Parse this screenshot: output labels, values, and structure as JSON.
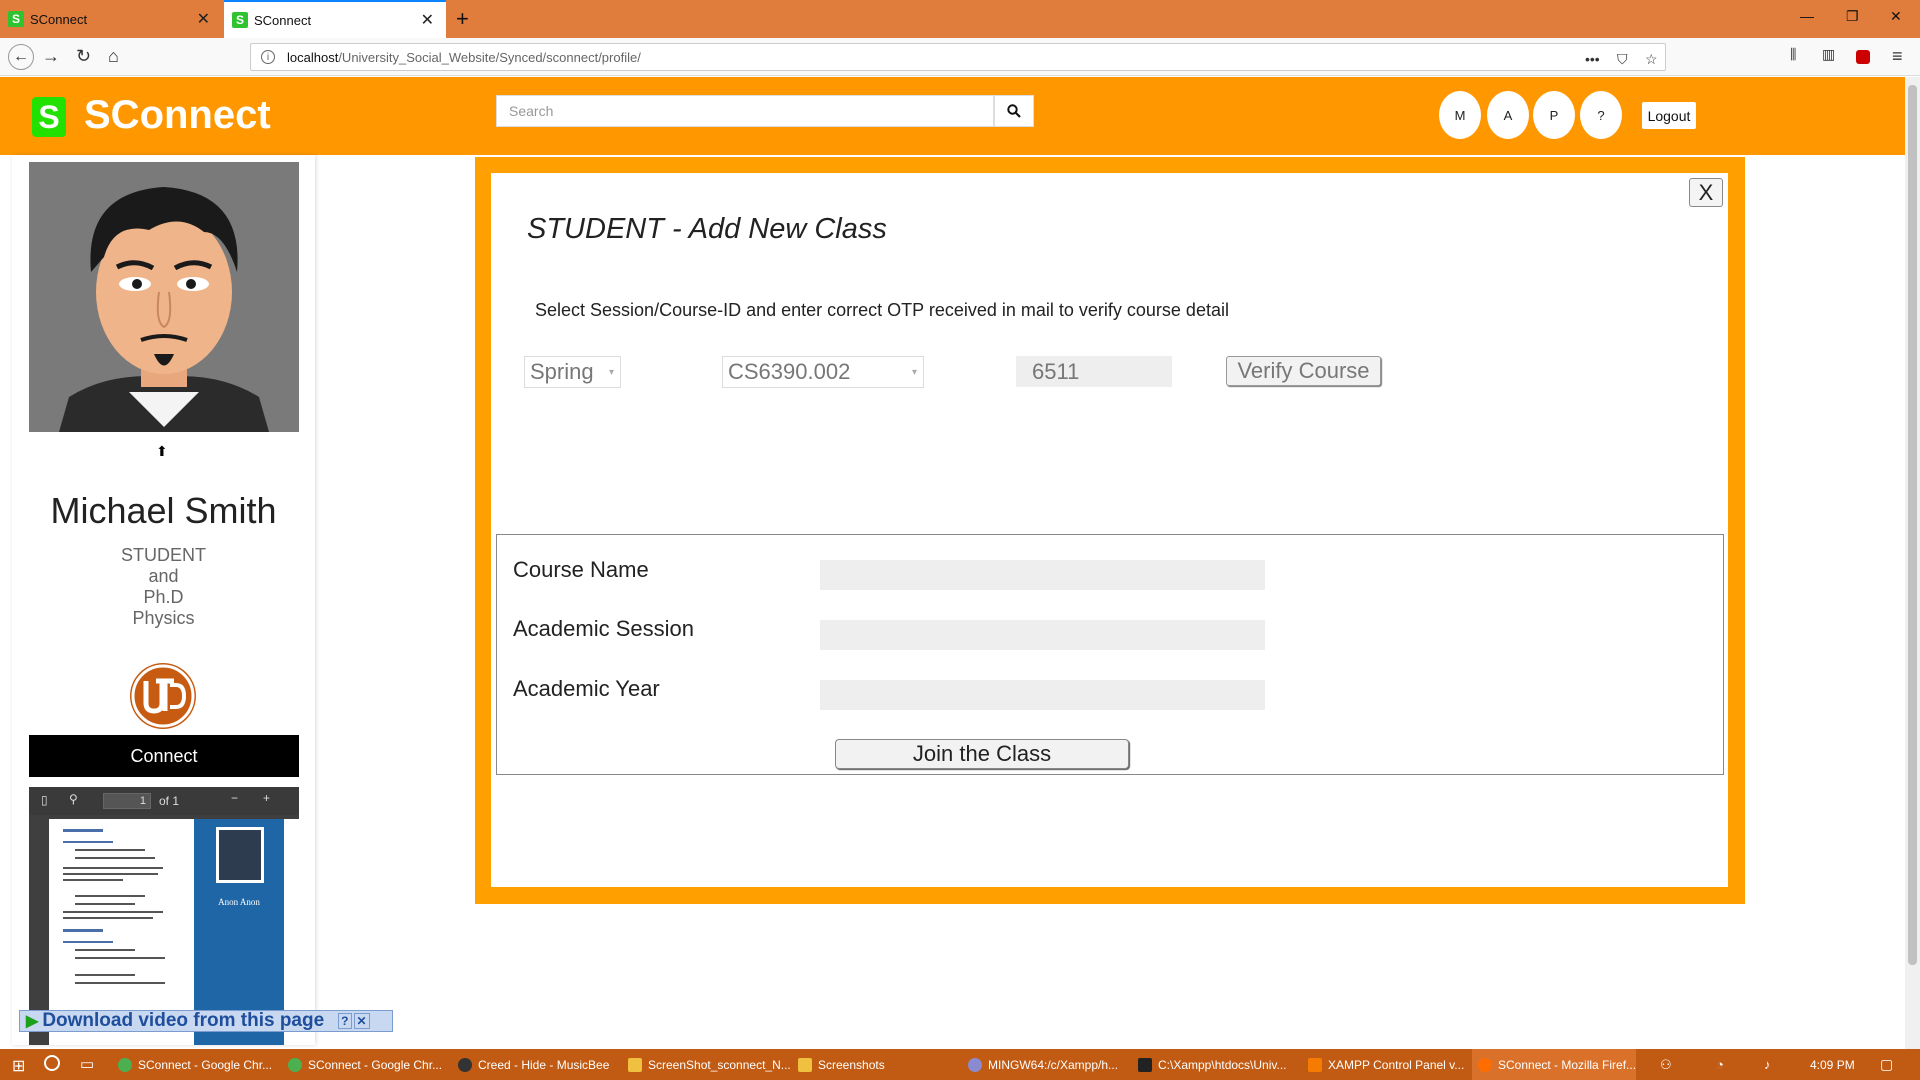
{
  "browser": {
    "tabs": [
      {
        "label": "SConnect",
        "favicon": "S"
      },
      {
        "label": "SConnect",
        "favicon": "S"
      }
    ],
    "url_host": "localhost",
    "url_path": "/University_Social_Website/Synced/sconnect/profile/",
    "info_glyph": "i",
    "new_tab_glyph": "+",
    "tab_close_glyph": "✕"
  },
  "header": {
    "logo_letter": "S",
    "title": "SConnect",
    "search_placeholder": "Search",
    "nav_buttons": [
      "M",
      "A",
      "P",
      "?"
    ],
    "logout_label": "Logout",
    "background_color": "#ff9800"
  },
  "profile": {
    "name": "Michael Smith",
    "lines": [
      "STUDENT",
      "and",
      "Ph.D",
      "Physics"
    ],
    "connect_label": "Connect",
    "pdf": {
      "page_value": "1",
      "page_total": "of 1",
      "person_name": "Anon Anon"
    }
  },
  "modal": {
    "close_label": "X",
    "title": "STUDENT - Add New Class",
    "description": "Select Session/Course-ID and enter correct OTP received in mail to verify course detail",
    "session_value": "Spring",
    "course_value": "CS6390.002",
    "otp_value": "6511",
    "verify_label": "Verify Course",
    "fields": [
      {
        "label": "Course Name",
        "value": ""
      },
      {
        "label": "Academic Session",
        "value": ""
      },
      {
        "label": "Academic Year",
        "value": ""
      }
    ],
    "join_label": "Join the Class",
    "border_color": "#ffa000"
  },
  "overlay": {
    "download_label": "Download video from this page"
  },
  "taskbar": {
    "items": [
      "SConnect - Google Chr...",
      "SConnect - Google Chr...",
      "Creed - Hide - MusicBee",
      "ScreenShot_sconnect_N...",
      "Screenshots",
      "MINGW64:/c/Xampp/h...",
      "C:\\Xampp\\htdocs\\Univ...",
      "XAMPP Control Panel v...",
      "SConnect - Mozilla Firef..."
    ],
    "time": "4:09 PM"
  }
}
